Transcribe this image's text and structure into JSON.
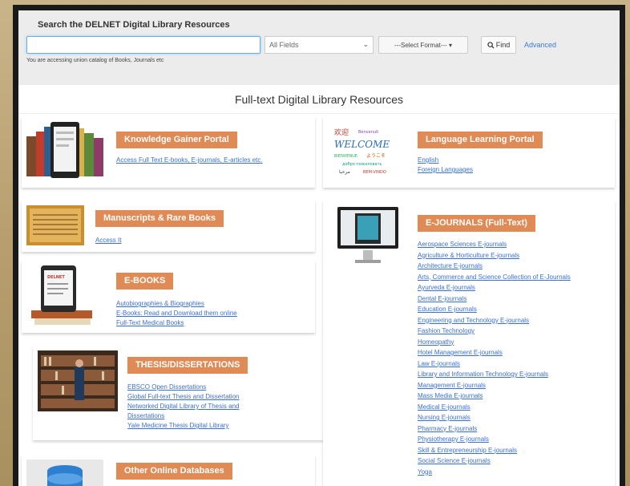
{
  "search": {
    "title": "Search the DELNET Digital Library Resources",
    "placeholder": "",
    "fields_value": "All Fields",
    "format_value": "---Select Format--- ▾",
    "find_label": "Find",
    "advanced_label": "Advanced",
    "union_note": "You are accessing union catalog of Books, Journals etc"
  },
  "main_title": "Full-text Digital Library Resources",
  "cards": {
    "knowledge": {
      "label": "Knowledge Gainer Portal",
      "links": [
        "Access Full Text E-books, E-journals, E-articles etc."
      ]
    },
    "language": {
      "label": "Language Learning Portal",
      "links": [
        "English",
        "Foreign Languages"
      ],
      "image_text": "WELCOME"
    },
    "manuscripts": {
      "label": "Manuscripts & Rare Books",
      "links": [
        "Access It"
      ]
    },
    "ebooks": {
      "label": "E-BOOKS",
      "links": [
        "Autobiographies & Biographies",
        "E-Books: Read and Download them online",
        "Full-Text Medical Books"
      ],
      "image_text": "DELNET"
    },
    "thesis": {
      "label": "THESIS/DISSERTATIONS",
      "links": [
        "EBSCO Open Dissertations",
        "Global Full-text Thesis and Dissertation",
        "Networked Digital Library of Thesis and Dissertations",
        "Yale Medicine Thesis Digital Library"
      ]
    },
    "ejournals": {
      "label": "E-JOURNALS (Full-Text)",
      "links": [
        "Aerospace Sciences E-journals",
        "Agriculture & Horticulture E-journals",
        "Architecture E-journals",
        "Arts, Commerce and Science Collection of E-Journals",
        "Ayurveda E-journals",
        "Dental E-journals",
        "Education E-journals",
        "Engineering and Technology E-journals",
        "Fashion Technology",
        "Homeopathy",
        "Hotel Management E-journals",
        "Law E-journals",
        "Library and Information Technology E-journals",
        "Management E-journals",
        "Mass Media E-journals",
        "Medical E-journals",
        "Nursing E-journals",
        "Pharmacy E-journals",
        "Physiotherapy E-journals",
        "Skill & Entrepreneurship E-journals",
        "Social Science E-journals",
        "Yoga"
      ]
    },
    "databases": {
      "label": "Other Online Databases"
    }
  },
  "colors": {
    "badge": "#e08a56",
    "link": "#3a6fd8",
    "search_band": "#ececec"
  }
}
